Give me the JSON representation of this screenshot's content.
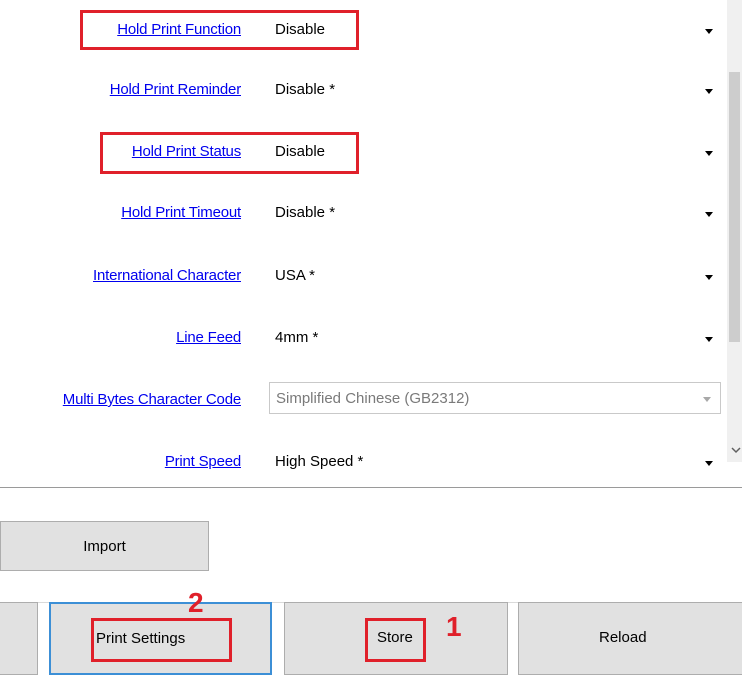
{
  "settings": [
    {
      "label": "Hold Print Function",
      "value": "Disable"
    },
    {
      "label": "Hold Print Reminder",
      "value": "Disable *"
    },
    {
      "label": "Hold Print Status",
      "value": "Disable"
    },
    {
      "label": "Hold Print Timeout",
      "value": "Disable *"
    },
    {
      "label": "International Character",
      "value": "USA *"
    },
    {
      "label": "Line Feed",
      "value": "4mm *"
    },
    {
      "label": "Multi Bytes Character Code",
      "value": "Simplified Chinese (GB2312)",
      "disabled": true
    },
    {
      "label": "Print Speed",
      "value": "High Speed *"
    }
  ],
  "import_label": "Import",
  "toolbar": {
    "print_settings_label": "Print Settings",
    "store_label": "Store",
    "reload_label": "Reload"
  },
  "annotations": {
    "store_step": "1",
    "print_settings_step": "2"
  },
  "colors": {
    "annotation": "#e0202a",
    "link": "#0000ee",
    "focus": "#3c8fd6"
  }
}
